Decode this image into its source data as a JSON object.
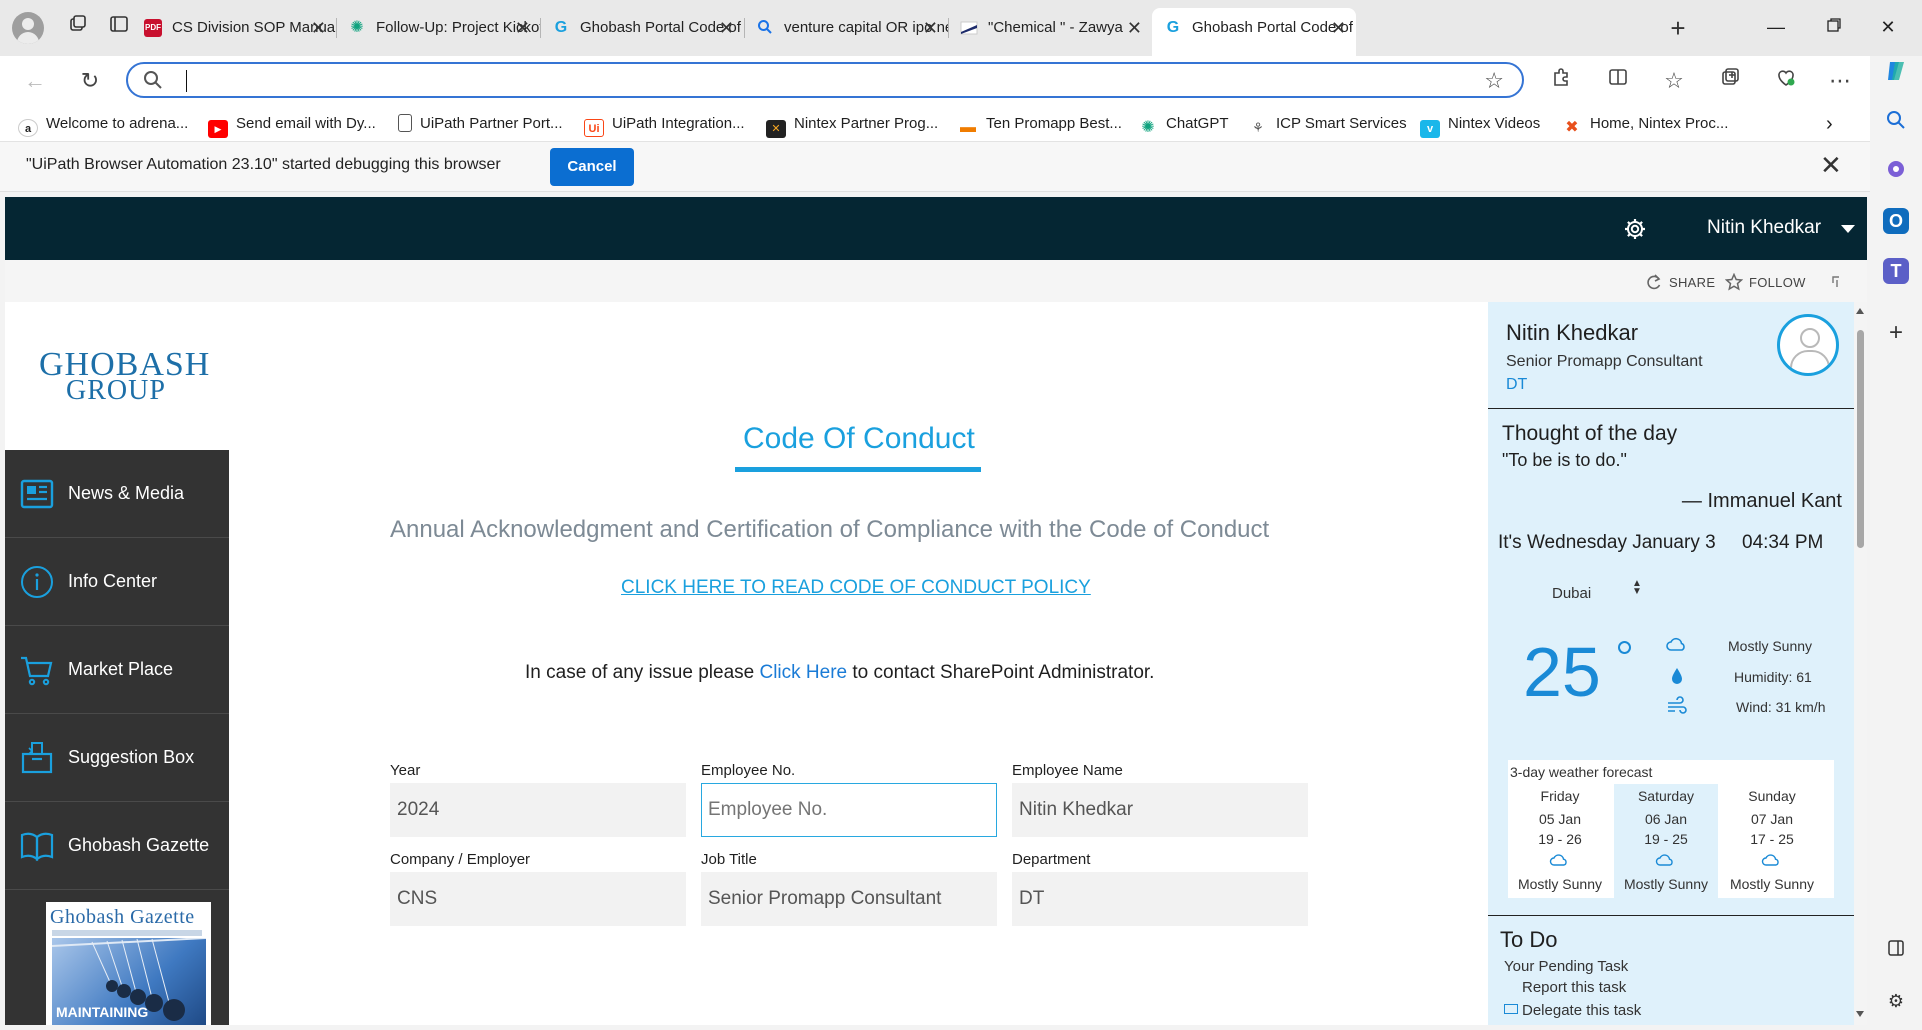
{
  "browser": {
    "tabs": [
      {
        "label": "CS Division SOP Manual.p",
        "favicon": "pdf-icon",
        "favicon_color": "#c8102e"
      },
      {
        "label": "Follow-Up: Project Kickoff",
        "favicon": "chatgpt-icon",
        "favicon_color": "#10a37f"
      },
      {
        "label": "Ghobash Portal Code of C",
        "favicon": "ghobash-icon",
        "favicon_color": "#1aa0de"
      },
      {
        "label": "venture capital OR ipo ne",
        "favicon": "search-icon",
        "favicon_color": "#1a73e8"
      },
      {
        "label": "\"Chemical \" - Zawya",
        "favicon": "zawya-icon",
        "favicon_color": "#1d2b6b"
      },
      {
        "label": "Ghobash Portal Code of C",
        "favicon": "ghobash-icon",
        "favicon_color": "#1aa0de"
      }
    ],
    "active_tab_index": 5,
    "address": {
      "value": "",
      "placeholder": ""
    },
    "favorites": [
      {
        "label": "Welcome to adrena...",
        "icon": "amazon-icon",
        "color": "#222"
      },
      {
        "label": "Send email with Dy...",
        "icon": "youtube-icon",
        "color": "#ff0000"
      },
      {
        "label": "UiPath Partner Port...",
        "icon": "page-icon",
        "color": "#555"
      },
      {
        "label": "UiPath Integration...",
        "icon": "uipath-icon",
        "color": "#fa4616"
      },
      {
        "label": "Nintex Partner Prog...",
        "icon": "nintex-icon",
        "color": "#222"
      },
      {
        "label": "Ten Promapp Best...",
        "icon": "promapp-icon",
        "color": "#f07c00"
      },
      {
        "label": "ChatGPT",
        "icon": "chatgpt-icon",
        "color": "#10a37f"
      },
      {
        "label": "ICP Smart Services",
        "icon": "icp-icon",
        "color": "#555"
      },
      {
        "label": "Nintex Videos",
        "icon": "vimeo-icon",
        "color": "#1ab7ea"
      },
      {
        "label": "Home, Nintex Proc...",
        "icon": "nintex-x-icon",
        "color": "#e8501c"
      }
    ],
    "infobar": {
      "message": "\"UiPath Browser Automation 23.10\" started debugging this browser",
      "cancel_label": "Cancel"
    },
    "accent": "#3574d4"
  },
  "portal": {
    "user_name": "Nitin Khedkar",
    "actions": {
      "share": "SHARE",
      "follow": "FOLLOW"
    },
    "logo": {
      "line1": "GHOBASH",
      "line2": "GROUP"
    },
    "nav": [
      {
        "label": "News & Media",
        "icon": "news-icon"
      },
      {
        "label": "Info Center",
        "icon": "info-icon"
      },
      {
        "label": "Market Place",
        "icon": "cart-icon"
      },
      {
        "label": "Suggestion Box",
        "icon": "suggestion-box-icon"
      },
      {
        "label": "Ghobash Gazette",
        "icon": "book-icon"
      }
    ],
    "gazette": {
      "title": "Ghobash Gazette",
      "caption": "MAINTAINING"
    },
    "brand_color": "#1aa0de",
    "nav_color": "#333333",
    "suitebar_color": "#052633"
  },
  "form": {
    "title": "Code Of Conduct",
    "subtitle": "Annual Acknowledgment and Certification of Compliance with the Code of Conduct",
    "policy_link": "CLICK HERE TO READ CODE OF CONDUCT POLICY",
    "issue_prefix": "In case of any issue please ",
    "issue_link": "Click Here",
    "issue_suffix": " to contact SharePoint Administrator.",
    "fields": {
      "year": {
        "label": "Year",
        "value": "2024"
      },
      "employee_no": {
        "label": "Employee No.",
        "value": "",
        "placeholder": "Employee No."
      },
      "employee_name": {
        "label": "Employee Name",
        "value": "Nitin Khedkar"
      },
      "company": {
        "label": "Company / Employer",
        "value": "CNS"
      },
      "job_title": {
        "label": "Job Title",
        "value": "Senior Promapp Consultant"
      },
      "department": {
        "label": "Department",
        "value": "DT"
      }
    }
  },
  "profile": {
    "name": "Nitin Khedkar",
    "role": "Senior Promapp Consultant",
    "dept": "DT"
  },
  "thought": {
    "heading": "Thought of the day",
    "quote": "\"To be is to do.\"",
    "author": "— Immanuel Kant"
  },
  "weather": {
    "date": "It's Wednesday January 3",
    "time": "04:34 PM",
    "city": "Dubai",
    "temp": "25",
    "condition": "Mostly Sunny",
    "humidity": "Humidity: 61",
    "wind": "Wind: 31 km/h",
    "forecast_heading": "3-day weather forecast",
    "forecast": [
      {
        "day": "Friday",
        "date": "05 Jan",
        "range": "19 - 26",
        "condition": "Mostly Sunny"
      },
      {
        "day": "Saturday",
        "date": "06 Jan",
        "range": "19 - 25",
        "condition": "Mostly Sunny"
      },
      {
        "day": "Sunday",
        "date": "07 Jan",
        "range": "17 - 25",
        "condition": "Mostly Sunny"
      }
    ],
    "highlight_index": 1
  },
  "todo": {
    "heading": "To Do",
    "pending": "Your Pending Task",
    "task1": "Report this task",
    "task2": "Delegate this task"
  }
}
